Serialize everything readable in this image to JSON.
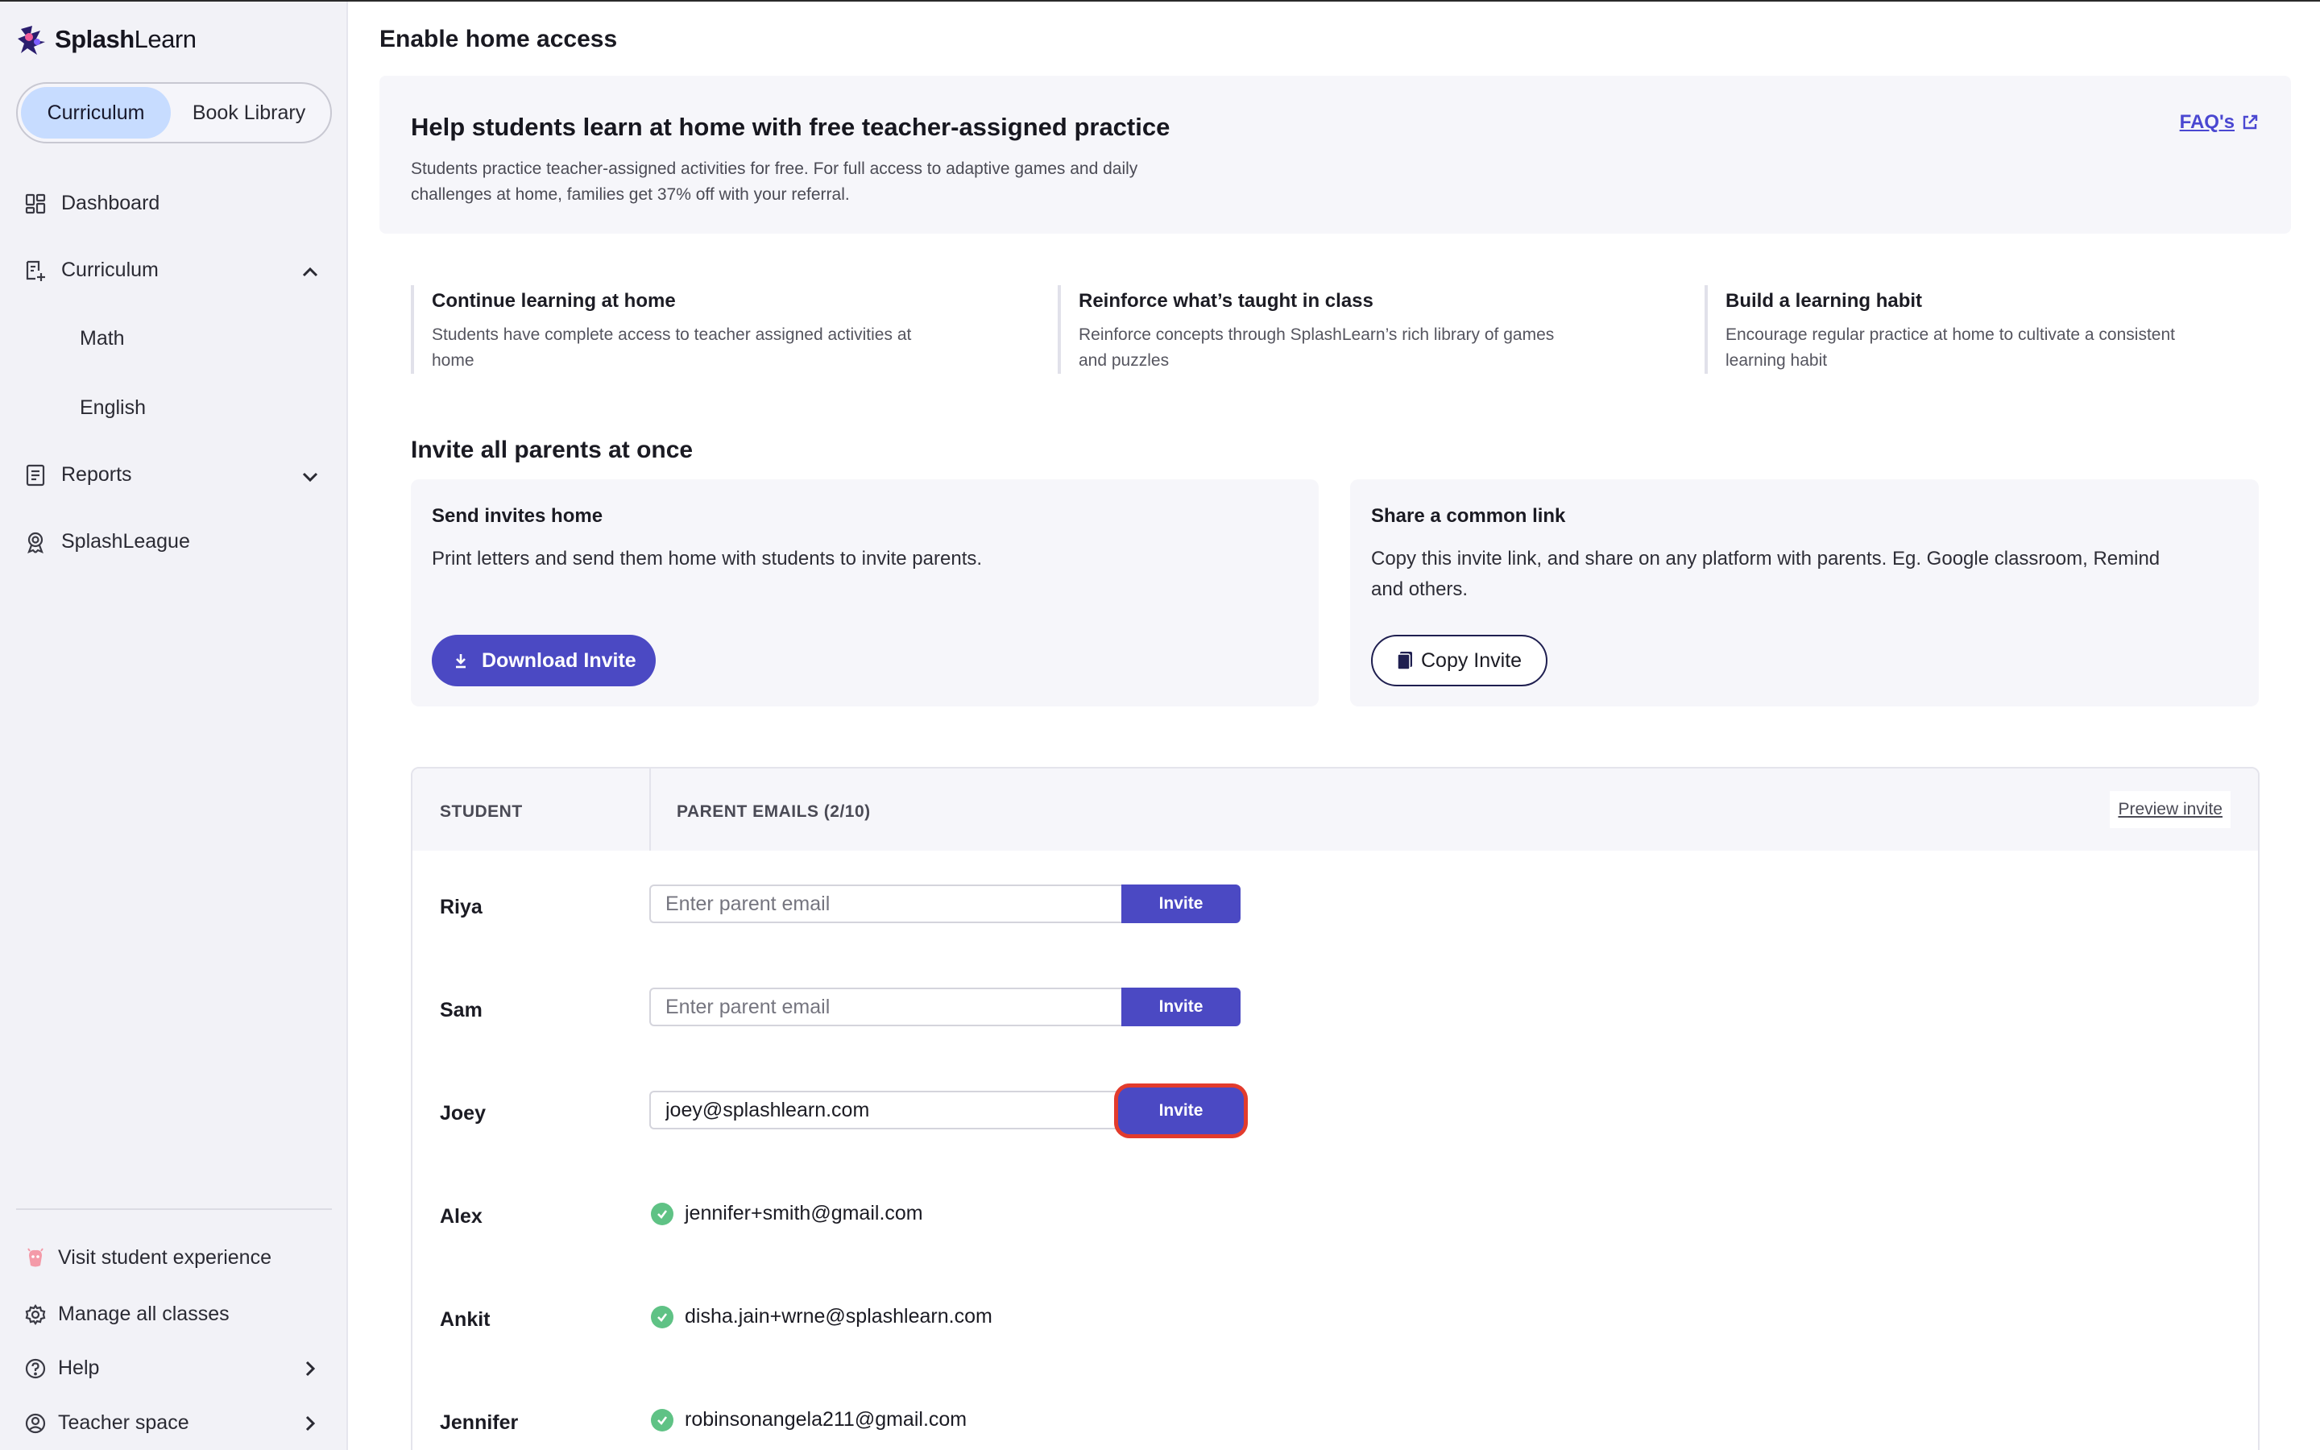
{
  "brand": {
    "name_bold": "Splash",
    "name_light": "Learn"
  },
  "sidebar": {
    "toggle": {
      "active": "Curriculum",
      "inactive": "Book Library"
    },
    "nav": [
      {
        "label": "Dashboard",
        "icon": "dashboard-icon"
      },
      {
        "label": "Curriculum",
        "icon": "curriculum-icon",
        "expanded": true
      },
      {
        "label": "Reports",
        "icon": "reports-icon",
        "expanded": false
      },
      {
        "label": "SplashLeague",
        "icon": "league-icon"
      }
    ],
    "sub_items": [
      "Math",
      "English"
    ],
    "bottom": [
      {
        "label": "Visit student experience",
        "icon": "student-experience-icon"
      },
      {
        "label": "Manage all classes",
        "icon": "gear-icon"
      },
      {
        "label": "Help",
        "icon": "help-icon"
      },
      {
        "label": "Teacher space",
        "icon": "teacher-icon"
      }
    ]
  },
  "main": {
    "page_title": "Enable home access",
    "hero": {
      "title": "Help students learn at home with free teacher-assigned practice",
      "description": "Students practice teacher-assigned activities for free. For full access to adaptive games and daily challenges at home, families get 37% off with your referral.",
      "faq_label": "FAQ's"
    },
    "benefits": [
      {
        "title": "Continue learning at home",
        "desc_1": "Students have complete access to teacher assigned activities at",
        "desc_2": "home"
      },
      {
        "title": "Reinforce what’s taught in class",
        "desc_1": "Reinforce concepts through SplashLearn’s rich library of games",
        "desc_2": "and puzzles"
      },
      {
        "title": "Build a learning habit",
        "desc_1": "Encourage regular practice at home to cultivate a consistent",
        "desc_2": "learning habit"
      }
    ],
    "invite_section_title": "Invite all parents at once",
    "send_card": {
      "title": "Send invites home",
      "desc": "Print letters and send them home with students to invite parents.",
      "button": "Download Invite"
    },
    "share_card": {
      "title": "Share a common link",
      "desc_1": "Copy this invite link, and share on any platform with parents. Eg. Google classroom, Remind",
      "desc_2": "and others.",
      "button": "Copy Invite"
    },
    "table": {
      "col_student": "STUDENT",
      "col_emails": "PARENT EMAILS (2/10)",
      "preview_link": "Preview invite",
      "placeholder": "Enter parent email",
      "invite_label": "Invite",
      "rows": [
        {
          "name": "Riya",
          "email": ""
        },
        {
          "name": "Sam",
          "email": ""
        },
        {
          "name": "Joey",
          "email": "joey@splashlearn.com"
        },
        {
          "name": "Alex",
          "invited_email": "jennifer+smith@gmail.com"
        },
        {
          "name": "Ankit",
          "invited_email": "disha.jain+wrne@splashlearn.com"
        },
        {
          "name": "Jennifer",
          "invited_email": "robinsonangela211@gmail.com"
        }
      ]
    }
  },
  "colors": {
    "accent": "#4b49c3",
    "highlight_ring": "#e23b2d",
    "success": "#5fc285",
    "active_toggle": "#c7dcff"
  }
}
